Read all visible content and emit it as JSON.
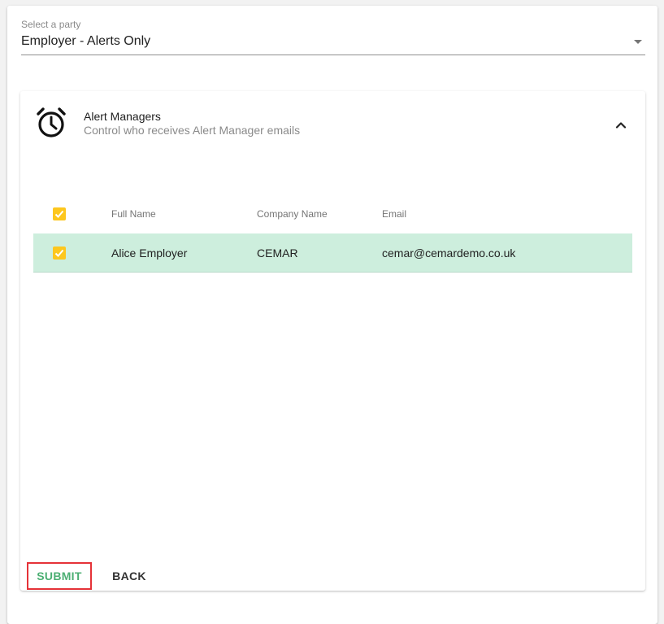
{
  "party_select": {
    "label": "Select a party",
    "value": "Employer - Alerts Only"
  },
  "panel": {
    "title": "Alert Managers",
    "subtitle": "Control who receives Alert Manager emails",
    "icon": "alarm-clock-icon",
    "expanded": true
  },
  "table": {
    "columns": [
      "Full Name",
      "Company Name",
      "Email"
    ],
    "header_checked": true,
    "rows": [
      {
        "checked": true,
        "full_name": "Alice Employer",
        "company_name": "CEMAR",
        "email": "cemar@cemardemo.co.uk"
      }
    ]
  },
  "actions": {
    "submit_label": "SUBMIT",
    "back_label": "BACK"
  },
  "colors": {
    "selected_row": "#cdeedd",
    "checkbox": "#fdc71e",
    "submit_text": "#4caf73",
    "highlight_box": "#e53238"
  }
}
